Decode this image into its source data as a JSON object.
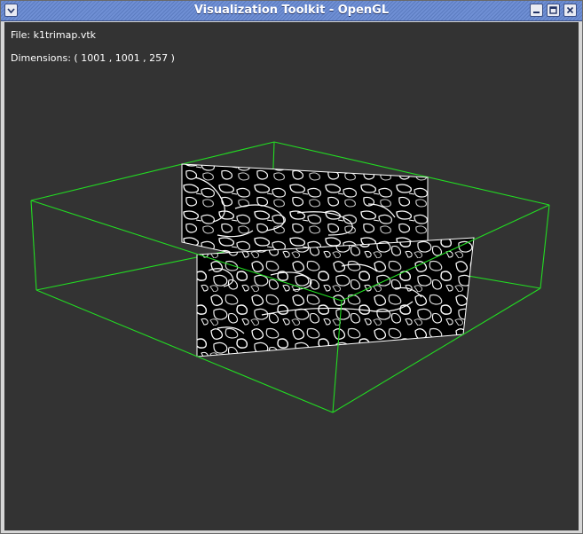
{
  "window": {
    "title": "Visualization Toolkit - OpenGL"
  },
  "overlay": {
    "file_label": "File:",
    "file_name": "k1trimap.vtk",
    "dimensions_label": "Dimensions:",
    "dimensions_value": "( 1001 , 1001 , 257 )"
  },
  "scene": {
    "bounding_box_color": "#22dd22",
    "background_color": "#333333",
    "slice_background_color": "#000000",
    "contour_color": "#ffffff"
  }
}
